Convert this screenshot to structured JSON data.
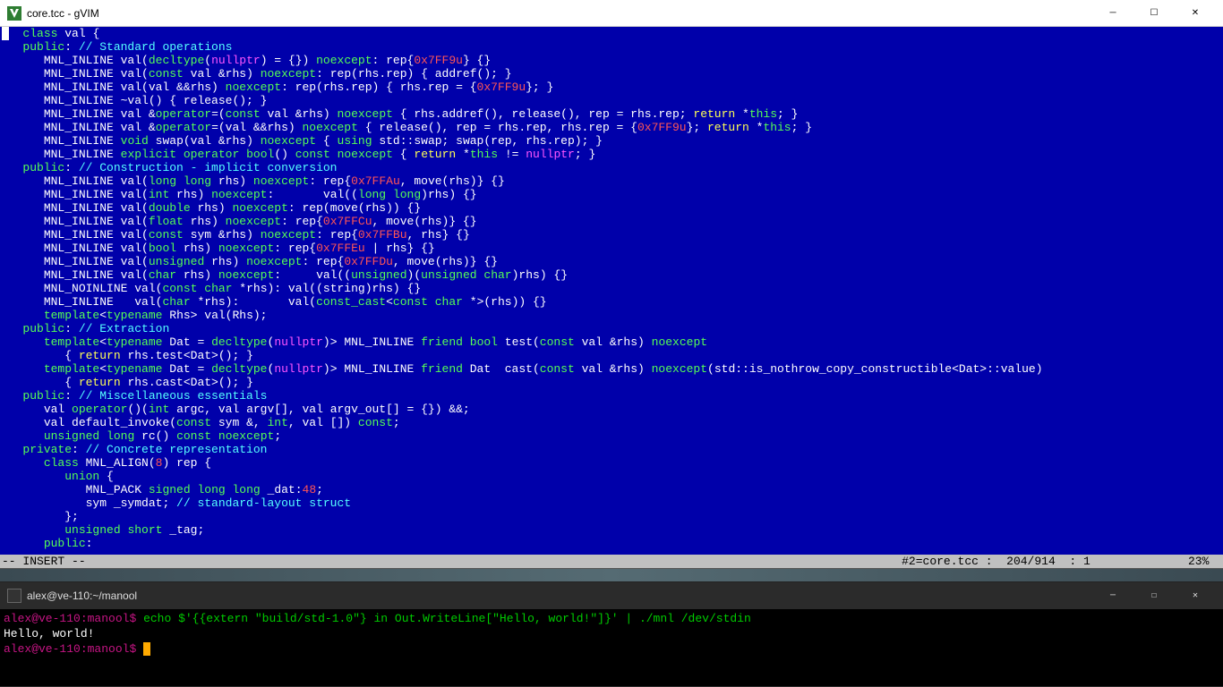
{
  "gvim": {
    "window_title": "core.tcc - gVIM",
    "status_mode": "-- INSERT --",
    "status_file": "#2=core.tcc :",
    "status_line": "204/914",
    "status_col": ": 1",
    "status_pct": "23%",
    "lines": [
      {
        "indent": "   ",
        "tokens": [
          {
            "c": "kw-green",
            "t": "class"
          },
          {
            "t": " val {"
          }
        ]
      },
      {
        "indent": "   ",
        "tokens": [
          {
            "c": "kw-green",
            "t": "public"
          },
          {
            "t": ": "
          },
          {
            "c": "kw-cyan",
            "t": "// Standard operations"
          }
        ]
      },
      {
        "indent": "      ",
        "tokens": [
          {
            "t": "MNL_INLINE val("
          },
          {
            "c": "kw-green",
            "t": "decltype"
          },
          {
            "t": "("
          },
          {
            "c": "kw-magenta",
            "t": "nullptr"
          },
          {
            "t": ") = {}) "
          },
          {
            "c": "kw-green",
            "t": "noexcept"
          },
          {
            "t": ": rep{"
          },
          {
            "c": "kw-red",
            "t": "0x7FF9u"
          },
          {
            "t": "} {}"
          }
        ]
      },
      {
        "indent": "      ",
        "tokens": [
          {
            "t": "MNL_INLINE val("
          },
          {
            "c": "kw-green",
            "t": "const"
          },
          {
            "t": " val &rhs) "
          },
          {
            "c": "kw-green",
            "t": "noexcept"
          },
          {
            "t": ": rep(rhs.rep) { addref(); }"
          }
        ]
      },
      {
        "indent": "      ",
        "tokens": [
          {
            "t": "MNL_INLINE val(val &&rhs) "
          },
          {
            "c": "kw-green",
            "t": "noexcept"
          },
          {
            "t": ": rep(rhs.rep) { rhs.rep = {"
          },
          {
            "c": "kw-red",
            "t": "0x7FF9u"
          },
          {
            "t": "}; }"
          }
        ]
      },
      {
        "indent": "      ",
        "tokens": [
          {
            "t": "MNL_INLINE ~val() { release(); }"
          }
        ]
      },
      {
        "indent": "      ",
        "tokens": [
          {
            "t": "MNL_INLINE val &"
          },
          {
            "c": "kw-green",
            "t": "operator"
          },
          {
            "t": "=("
          },
          {
            "c": "kw-green",
            "t": "const"
          },
          {
            "t": " val &rhs) "
          },
          {
            "c": "kw-green",
            "t": "noexcept"
          },
          {
            "t": " { rhs.addref(), release(), rep = rhs.rep; "
          },
          {
            "c": "kw-yellow",
            "t": "return"
          },
          {
            "t": " *"
          },
          {
            "c": "kw-green",
            "t": "this"
          },
          {
            "t": "; }"
          }
        ]
      },
      {
        "indent": "      ",
        "tokens": [
          {
            "t": "MNL_INLINE val &"
          },
          {
            "c": "kw-green",
            "t": "operator"
          },
          {
            "t": "=(val &&rhs) "
          },
          {
            "c": "kw-green",
            "t": "noexcept"
          },
          {
            "t": " { release(), rep = rhs.rep, rhs.rep = {"
          },
          {
            "c": "kw-red",
            "t": "0x7FF9u"
          },
          {
            "t": "}; "
          },
          {
            "c": "kw-yellow",
            "t": "return"
          },
          {
            "t": " *"
          },
          {
            "c": "kw-green",
            "t": "this"
          },
          {
            "t": "; }"
          }
        ]
      },
      {
        "indent": "      ",
        "tokens": [
          {
            "t": "MNL_INLINE "
          },
          {
            "c": "kw-green",
            "t": "void"
          },
          {
            "t": " swap(val &rhs) "
          },
          {
            "c": "kw-green",
            "t": "noexcept"
          },
          {
            "t": " { "
          },
          {
            "c": "kw-green",
            "t": "using"
          },
          {
            "t": " std::swap; swap(rep, rhs.rep); }"
          }
        ]
      },
      {
        "indent": "      ",
        "tokens": [
          {
            "t": "MNL_INLINE "
          },
          {
            "c": "kw-green",
            "t": "explicit"
          },
          {
            "t": " "
          },
          {
            "c": "kw-green",
            "t": "operator"
          },
          {
            "t": " "
          },
          {
            "c": "kw-green",
            "t": "bool"
          },
          {
            "t": "() "
          },
          {
            "c": "kw-green",
            "t": "const"
          },
          {
            "t": " "
          },
          {
            "c": "kw-green",
            "t": "noexcept"
          },
          {
            "t": " { "
          },
          {
            "c": "kw-yellow",
            "t": "return"
          },
          {
            "t": " *"
          },
          {
            "c": "kw-green",
            "t": "this"
          },
          {
            "t": " != "
          },
          {
            "c": "kw-magenta",
            "t": "nullptr"
          },
          {
            "t": "; }"
          }
        ]
      },
      {
        "indent": "   ",
        "tokens": [
          {
            "c": "kw-green",
            "t": "public"
          },
          {
            "t": ": "
          },
          {
            "c": "kw-cyan",
            "t": "// Construction - implicit conversion"
          }
        ]
      },
      {
        "indent": "      ",
        "tokens": [
          {
            "t": "MNL_INLINE val("
          },
          {
            "c": "kw-green",
            "t": "long"
          },
          {
            "t": " "
          },
          {
            "c": "kw-green",
            "t": "long"
          },
          {
            "t": " rhs) "
          },
          {
            "c": "kw-green",
            "t": "noexcept"
          },
          {
            "t": ": rep{"
          },
          {
            "c": "kw-red",
            "t": "0x7FFAu"
          },
          {
            "t": ", move(rhs)} {}"
          }
        ]
      },
      {
        "indent": "      ",
        "tokens": [
          {
            "t": "MNL_INLINE val("
          },
          {
            "c": "kw-green",
            "t": "int"
          },
          {
            "t": " rhs) "
          },
          {
            "c": "kw-green",
            "t": "noexcept"
          },
          {
            "t": ":       val(("
          },
          {
            "c": "kw-green",
            "t": "long"
          },
          {
            "t": " "
          },
          {
            "c": "kw-green",
            "t": "long"
          },
          {
            "t": ")rhs) {}"
          }
        ]
      },
      {
        "indent": "      ",
        "tokens": [
          {
            "t": "MNL_INLINE val("
          },
          {
            "c": "kw-green",
            "t": "double"
          },
          {
            "t": " rhs) "
          },
          {
            "c": "kw-green",
            "t": "noexcept"
          },
          {
            "t": ": rep(move(rhs)) {}"
          }
        ]
      },
      {
        "indent": "      ",
        "tokens": [
          {
            "t": "MNL_INLINE val("
          },
          {
            "c": "kw-green",
            "t": "float"
          },
          {
            "t": " rhs) "
          },
          {
            "c": "kw-green",
            "t": "noexcept"
          },
          {
            "t": ": rep{"
          },
          {
            "c": "kw-red",
            "t": "0x7FFCu"
          },
          {
            "t": ", move(rhs)} {}"
          }
        ]
      },
      {
        "indent": "      ",
        "tokens": [
          {
            "t": "MNL_INLINE val("
          },
          {
            "c": "kw-green",
            "t": "const"
          },
          {
            "t": " sym &rhs) "
          },
          {
            "c": "kw-green",
            "t": "noexcept"
          },
          {
            "t": ": rep{"
          },
          {
            "c": "kw-red",
            "t": "0x7FFBu"
          },
          {
            "t": ", rhs} {}"
          }
        ]
      },
      {
        "indent": "      ",
        "tokens": [
          {
            "t": "MNL_INLINE val("
          },
          {
            "c": "kw-green",
            "t": "bool"
          },
          {
            "t": " rhs) "
          },
          {
            "c": "kw-green",
            "t": "noexcept"
          },
          {
            "t": ": rep{"
          },
          {
            "c": "kw-red",
            "t": "0x7FFEu"
          },
          {
            "t": " | rhs} {}"
          }
        ]
      },
      {
        "indent": "      ",
        "tokens": [
          {
            "t": "MNL_INLINE val("
          },
          {
            "c": "kw-green",
            "t": "unsigned"
          },
          {
            "t": " rhs) "
          },
          {
            "c": "kw-green",
            "t": "noexcept"
          },
          {
            "t": ": rep{"
          },
          {
            "c": "kw-red",
            "t": "0x7FFDu"
          },
          {
            "t": ", move(rhs)} {}"
          }
        ]
      },
      {
        "indent": "      ",
        "tokens": [
          {
            "t": "MNL_INLINE val("
          },
          {
            "c": "kw-green",
            "t": "char"
          },
          {
            "t": " rhs) "
          },
          {
            "c": "kw-green",
            "t": "noexcept"
          },
          {
            "t": ":     val(("
          },
          {
            "c": "kw-green",
            "t": "unsigned"
          },
          {
            "t": ")("
          },
          {
            "c": "kw-green",
            "t": "unsigned"
          },
          {
            "t": " "
          },
          {
            "c": "kw-green",
            "t": "char"
          },
          {
            "t": ")rhs) {}"
          }
        ]
      },
      {
        "indent": "      ",
        "tokens": [
          {
            "t": "MNL_NOINLINE val("
          },
          {
            "c": "kw-green",
            "t": "const"
          },
          {
            "t": " "
          },
          {
            "c": "kw-green",
            "t": "char"
          },
          {
            "t": " *rhs): val((string)rhs) {}"
          }
        ]
      },
      {
        "indent": "      ",
        "tokens": [
          {
            "t": "MNL_INLINE   val("
          },
          {
            "c": "kw-green",
            "t": "char"
          },
          {
            "t": " *rhs):       val("
          },
          {
            "c": "kw-green",
            "t": "const_cast"
          },
          {
            "t": "<"
          },
          {
            "c": "kw-green",
            "t": "const"
          },
          {
            "t": " "
          },
          {
            "c": "kw-green",
            "t": "char"
          },
          {
            "t": " *>(rhs)) {}"
          }
        ]
      },
      {
        "indent": "      ",
        "tokens": [
          {
            "c": "kw-green",
            "t": "template"
          },
          {
            "t": "<"
          },
          {
            "c": "kw-green",
            "t": "typename"
          },
          {
            "t": " Rhs> val(Rhs);"
          }
        ]
      },
      {
        "indent": "   ",
        "tokens": [
          {
            "c": "kw-green",
            "t": "public"
          },
          {
            "t": ": "
          },
          {
            "c": "kw-cyan",
            "t": "// Extraction"
          }
        ]
      },
      {
        "indent": "      ",
        "tokens": [
          {
            "c": "kw-green",
            "t": "template"
          },
          {
            "t": "<"
          },
          {
            "c": "kw-green",
            "t": "typename"
          },
          {
            "t": " Dat = "
          },
          {
            "c": "kw-green",
            "t": "decltype"
          },
          {
            "t": "("
          },
          {
            "c": "kw-magenta",
            "t": "nullptr"
          },
          {
            "t": ")> MNL_INLINE "
          },
          {
            "c": "kw-green",
            "t": "friend"
          },
          {
            "t": " "
          },
          {
            "c": "kw-green",
            "t": "bool"
          },
          {
            "t": " test("
          },
          {
            "c": "kw-green",
            "t": "const"
          },
          {
            "t": " val &rhs) "
          },
          {
            "c": "kw-green",
            "t": "noexcept"
          }
        ]
      },
      {
        "indent": "         ",
        "tokens": [
          {
            "t": "{ "
          },
          {
            "c": "kw-yellow",
            "t": "return"
          },
          {
            "t": " rhs.test<Dat>(); }"
          }
        ]
      },
      {
        "indent": "      ",
        "tokens": [
          {
            "c": "kw-green",
            "t": "template"
          },
          {
            "t": "<"
          },
          {
            "c": "kw-green",
            "t": "typename"
          },
          {
            "t": " Dat = "
          },
          {
            "c": "kw-green",
            "t": "decltype"
          },
          {
            "t": "("
          },
          {
            "c": "kw-magenta",
            "t": "nullptr"
          },
          {
            "t": ")> MNL_INLINE "
          },
          {
            "c": "kw-green",
            "t": "friend"
          },
          {
            "t": " Dat  cast("
          },
          {
            "c": "kw-green",
            "t": "const"
          },
          {
            "t": " val &rhs) "
          },
          {
            "c": "kw-green",
            "t": "noexcept"
          },
          {
            "t": "(std::is_nothrow_copy_constructible<Dat>::value)"
          }
        ]
      },
      {
        "indent": "         ",
        "tokens": [
          {
            "t": "{ "
          },
          {
            "c": "kw-yellow",
            "t": "return"
          },
          {
            "t": " rhs.cast<Dat>(); }"
          }
        ]
      },
      {
        "indent": "   ",
        "tokens": [
          {
            "c": "kw-green",
            "t": "public"
          },
          {
            "t": ": "
          },
          {
            "c": "kw-cyan",
            "t": "// Miscellaneous essentials"
          }
        ]
      },
      {
        "indent": "      ",
        "tokens": [
          {
            "t": "val "
          },
          {
            "c": "kw-green",
            "t": "operator"
          },
          {
            "t": "()("
          },
          {
            "c": "kw-green",
            "t": "int"
          },
          {
            "t": " argc, val argv[], val argv_out[] = {}) &&;"
          }
        ]
      },
      {
        "indent": "      ",
        "tokens": [
          {
            "t": "val default_invoke("
          },
          {
            "c": "kw-green",
            "t": "const"
          },
          {
            "t": " sym &, "
          },
          {
            "c": "kw-green",
            "t": "int"
          },
          {
            "t": ", val []) "
          },
          {
            "c": "kw-green",
            "t": "const"
          },
          {
            "t": ";"
          }
        ]
      },
      {
        "indent": "      ",
        "tokens": [
          {
            "c": "kw-green",
            "t": "unsigned"
          },
          {
            "t": " "
          },
          {
            "c": "kw-green",
            "t": "long"
          },
          {
            "t": " rc() "
          },
          {
            "c": "kw-green",
            "t": "const"
          },
          {
            "t": " "
          },
          {
            "c": "kw-green",
            "t": "noexcept"
          },
          {
            "t": ";"
          }
        ]
      },
      {
        "indent": "   ",
        "tokens": [
          {
            "c": "kw-green",
            "t": "private"
          },
          {
            "t": ": "
          },
          {
            "c": "kw-cyan",
            "t": "// Concrete representation"
          }
        ]
      },
      {
        "indent": "      ",
        "tokens": [
          {
            "c": "kw-green",
            "t": "class"
          },
          {
            "t": " MNL_ALIGN("
          },
          {
            "c": "kw-red",
            "t": "8"
          },
          {
            "t": ") rep {"
          }
        ]
      },
      {
        "indent": "         ",
        "tokens": [
          {
            "c": "kw-green",
            "t": "union"
          },
          {
            "t": " {"
          }
        ]
      },
      {
        "indent": "            ",
        "tokens": [
          {
            "t": "MNL_PACK "
          },
          {
            "c": "kw-green",
            "t": "signed"
          },
          {
            "t": " "
          },
          {
            "c": "kw-green",
            "t": "long"
          },
          {
            "t": " "
          },
          {
            "c": "kw-green",
            "t": "long"
          },
          {
            "t": " _dat:"
          },
          {
            "c": "kw-red",
            "t": "48"
          },
          {
            "t": ";"
          }
        ]
      },
      {
        "indent": "            ",
        "tokens": [
          {
            "t": "sym _symdat; "
          },
          {
            "c": "kw-cyan",
            "t": "// standard-layout struct"
          }
        ]
      },
      {
        "indent": "         ",
        "tokens": [
          {
            "t": "};"
          }
        ]
      },
      {
        "indent": "         ",
        "tokens": [
          {
            "c": "kw-green",
            "t": "unsigned"
          },
          {
            "t": " "
          },
          {
            "c": "kw-green",
            "t": "short"
          },
          {
            "t": " _tag;"
          }
        ]
      },
      {
        "indent": "      ",
        "tokens": [
          {
            "c": "kw-green",
            "t": "public"
          },
          {
            "t": ":"
          }
        ]
      }
    ]
  },
  "terminal": {
    "window_title": "alex@ve-110:~/manool",
    "prompt1_host": "alex@ve-110:",
    "prompt1_path": "manool",
    "prompt1_dollar": "$",
    "cmd1": "echo $'{{extern \"build/std-1.0\"} in Out.WriteLine[\"Hello, world!\"]}' | ./mnl /dev/stdin",
    "output": "Hello, world!",
    "prompt2_host": "alex@ve-110:",
    "prompt2_path": "manool",
    "prompt2_dollar": "$"
  }
}
